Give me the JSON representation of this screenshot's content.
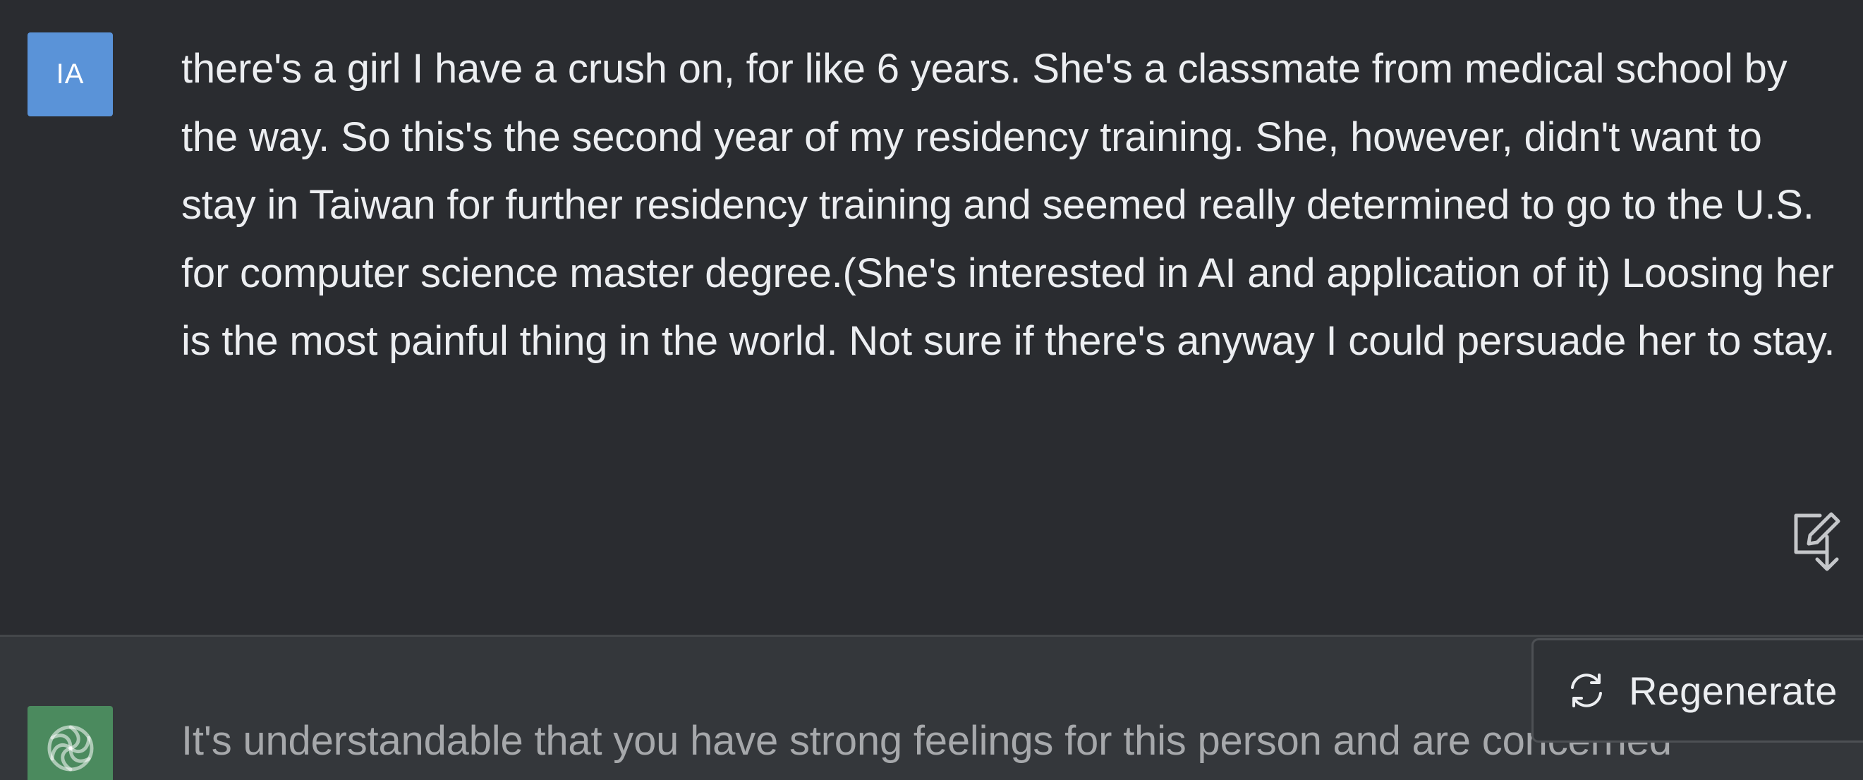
{
  "user_message": {
    "avatar_initials": "IA",
    "avatar_color": "#5a93d8",
    "text": "there's a girl I have a crush on, for like 6 years. She's a classmate from medical school by the way. So this's the second year of my residency training. She, however, didn't want to stay in Taiwan for further residency training and seemed really determined to go to the U.S. for computer science master degree.(She's interested in AI and application of it) Loosing her is the most painful thing in the world. Not sure if there's anyway I could persuade her to stay.",
    "edit_icon": "edit-icon"
  },
  "assistant_message": {
    "avatar_icon": "openai-logo-icon",
    "avatar_color": "#4b8a5e",
    "text": "It's understandable that you have strong feelings for this person and are concerned"
  },
  "regenerate_button": {
    "label": "Regenerate",
    "icon": "refresh-icon"
  }
}
